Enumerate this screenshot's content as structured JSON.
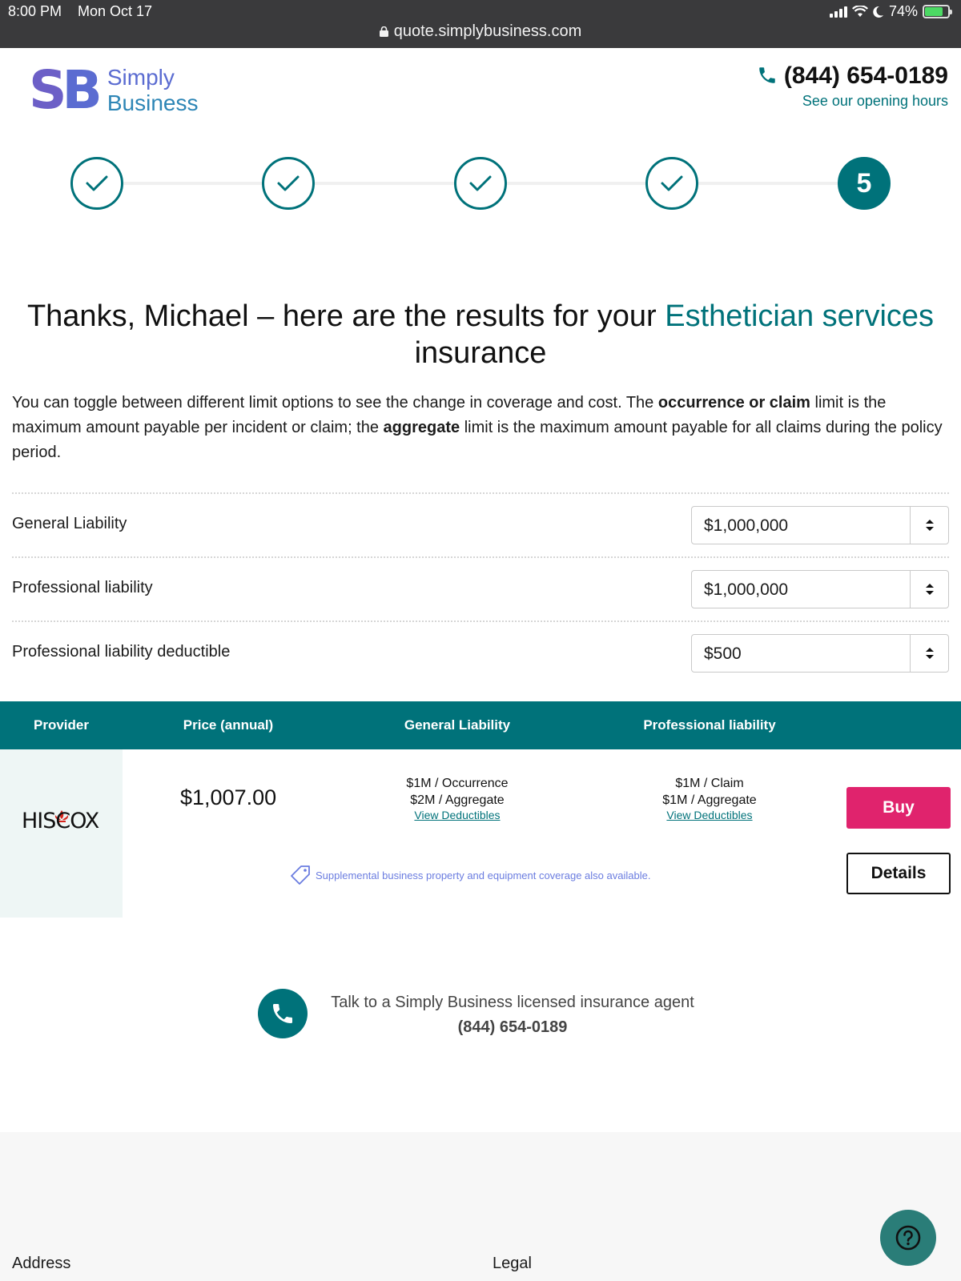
{
  "status_bar": {
    "time": "8:00 PM",
    "date": "Mon Oct 17",
    "url": "quote.simplybusiness.com",
    "battery": "74%"
  },
  "brand": {
    "mark": "SB",
    "name_line1": "Simply",
    "name_line2": "Business"
  },
  "contact": {
    "phone": "(844) 654-0189",
    "hours_link": "See our opening hours"
  },
  "progress": {
    "current_step": "5",
    "completed_steps": 4,
    "total_steps": 5
  },
  "heading": {
    "prefix": "Thanks, Michael – here are the results for your ",
    "highlight": "Esthetician services",
    "suffix": "insurance"
  },
  "intro": {
    "part1": "You can toggle between different limit options to see the change in coverage and cost. The ",
    "bold1": "occurrence or claim",
    "part2": " limit is the maximum amount payable per incident or claim; the ",
    "bold2": "aggregate",
    "part3": " limit is the maximum amount payable for all claims during the policy period."
  },
  "limits": [
    {
      "label": "General Liability",
      "value": "$1,000,000"
    },
    {
      "label": "Professional liability",
      "value": "$1,000,000"
    },
    {
      "label": "Professional liability deductible",
      "value": "$500"
    }
  ],
  "table": {
    "headers": {
      "provider": "Provider",
      "price": "Price (annual)",
      "gl": "General Liability",
      "pl": "Professional liability"
    },
    "row": {
      "provider": "HISCOX",
      "price": "$1,007.00",
      "gl_line1": "$1M / Occurrence",
      "gl_line2": "$2M / Aggregate",
      "pl_line1": "$1M / Claim",
      "pl_line2": "$1M / Aggregate",
      "deductibles_link": "View Deductibles",
      "buy_label": "Buy",
      "details_label": "Details",
      "supplemental": "Supplemental business property and equipment coverage also available."
    }
  },
  "agent": {
    "text": "Talk to a Simply Business licensed insurance agent",
    "phone": "(844) 654-0189"
  },
  "footer": {
    "col1": "Address",
    "col2": "Legal"
  },
  "colors": {
    "teal": "#00727a",
    "pink": "#e0236d",
    "brand_purple": "#6c5fc7",
    "brand_blue": "#2e86b6"
  }
}
